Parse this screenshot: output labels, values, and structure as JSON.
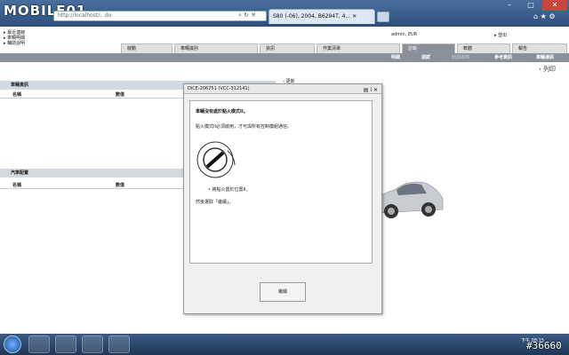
{
  "browser": {
    "logo_text": "MOBILE01",
    "url": "http://localhost/...do",
    "tab_title": "S80 (-06), 2004, B6294T, 4...",
    "window_controls": [
      "–",
      "□",
      "✕"
    ]
  },
  "quick_links": [
    "最近連線",
    "車輛明細",
    "輔助說明"
  ],
  "user": {
    "label": "admin, EUR",
    "logout": "登出"
  },
  "main_tabs": [
    "啟動",
    "車輛識別",
    "資訊",
    "作業清單",
    "診斷",
    "軟體",
    "報告"
  ],
  "active_main_tab": "診斷",
  "sub_tabs": [
    {
      "label": "明細",
      "dim": false
    },
    {
      "label": "測試",
      "dim": false
    },
    {
      "label": "偵測故障",
      "dim": true
    },
    {
      "label": "參考資訊",
      "dim": false
    },
    {
      "label": "車輛通訊",
      "dim": false
    }
  ],
  "print_label": "列印",
  "update_label": "更新",
  "panels": {
    "vehicle_info": {
      "title": "車輛資訊",
      "col_name": "名稱",
      "col_value": "數值"
    },
    "vehicle_config": {
      "title": "汽車配置",
      "col_name": "名稱",
      "col_value": "數值"
    }
  },
  "dialog": {
    "title": "DiCE-206751 (VCC-312141)",
    "heading": "車輛沒有處於點火模式II。",
    "text": "點火模式II必須啟用，才可與所有控制模組通信。",
    "bullet": "將點火置於位置II。",
    "footer": "然後選取「繼續」。",
    "continue_button": "繼續"
  },
  "taskbar": {
    "tray_text": "下午 08:15"
  },
  "watermark": "#36660"
}
